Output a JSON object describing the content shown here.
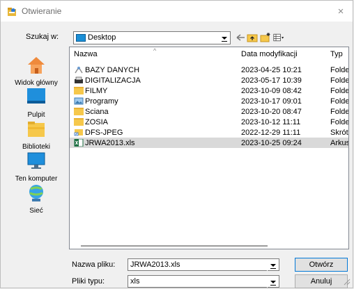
{
  "window": {
    "title": "Otwieranie",
    "close_symbol": "×"
  },
  "lookin": {
    "label": "Szukaj w:",
    "value": "Desktop"
  },
  "places": [
    {
      "label": "Widok główny",
      "icon": "home-icon"
    },
    {
      "label": "Pulpit",
      "icon": "desktop-icon"
    },
    {
      "label": "Biblioteki",
      "icon": "libraries-icon"
    },
    {
      "label": "Ten komputer",
      "icon": "computer-icon"
    },
    {
      "label": "Sieć",
      "icon": "network-icon"
    }
  ],
  "columns": {
    "name": "Nazwa",
    "date": "Data modyfikacji",
    "type": "Typ"
  },
  "files": [
    {
      "name": "BAZY DANYCH",
      "date": "2023-04-25 10:21",
      "type": "Folde",
      "icon": "shortcut-folder-icon"
    },
    {
      "name": "DIGITALIZACJA",
      "date": "2023-05-17 10:39",
      "type": "Folde",
      "icon": "printer-folder-icon"
    },
    {
      "name": "FILMY",
      "date": "2023-10-09 08:42",
      "type": "Folde",
      "icon": "folder-icon"
    },
    {
      "name": "Programy",
      "date": "2023-10-17 09:01",
      "type": "Folde",
      "icon": "image-folder-icon"
    },
    {
      "name": "Sciana",
      "date": "2023-10-20 08:47",
      "type": "Folde",
      "icon": "folder-icon"
    },
    {
      "name": "ZOSIA",
      "date": "2023-10-12 11:11",
      "type": "Folde",
      "icon": "folder-icon"
    },
    {
      "name": "DFS-JPEG",
      "date": "2022-12-29 11:11",
      "type": "Skrót",
      "icon": "shortcut-icon"
    },
    {
      "name": "JRWA2013.xls",
      "date": "2023-10-25 09:24",
      "type": "Arkus",
      "icon": "excel-file-icon",
      "selected": true
    }
  ],
  "filename": {
    "label": "Nazwa pliku:",
    "value": "JRWA2013.xls"
  },
  "filetype": {
    "label": "Pliki typu:",
    "value": "xls"
  },
  "buttons": {
    "open": "Otwórz",
    "cancel": "Anuluj"
  },
  "colors": {
    "selection": "#d9d9d9",
    "folder": "#f6c84b",
    "accent": "#0078d7"
  }
}
